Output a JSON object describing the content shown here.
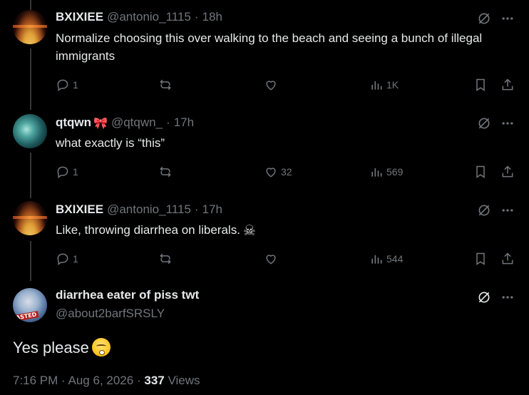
{
  "replies": [
    {
      "name": "BXIXIEE",
      "handle": "@antonio_1115",
      "time": "18h",
      "text": "Normalize choosing this over walking to the beach and seeing a bunch of illegal immigrants",
      "replies": "1",
      "reposts": "",
      "likes": "",
      "views": "1K"
    },
    {
      "name": "qtqwn",
      "handle": "@qtqwn_",
      "time": "17h",
      "text": "what exactly is “this”",
      "replies": "1",
      "reposts": "",
      "likes": "32",
      "views": "569"
    },
    {
      "name": "BXIXIEE",
      "handle": "@antonio_1115",
      "time": "17h",
      "text": "Like, throwing diarrhea on liberals.",
      "replies": "1",
      "reposts": "",
      "likes": "",
      "views": "544"
    }
  ],
  "main_tweet": {
    "name": "diarrhea eater of piss twt",
    "handle": "@about2barfSRSLY",
    "text": "Yes please",
    "time": "7:16 PM",
    "date": "Aug 6, 2026",
    "views_count": "337",
    "views_label": "Views",
    "avatar_stamp": "ASTED"
  },
  "icons": {
    "grok": "grok-icon",
    "more": "more-icon",
    "reply": "reply-icon",
    "repost": "repost-icon",
    "like": "heart-icon",
    "views": "views-icon",
    "bookmark": "bookmark-icon",
    "share": "share-icon"
  },
  "separator": "·",
  "emojis": {
    "bow": "🎀",
    "skull": "☠"
  },
  "colors": {
    "background": "#000000",
    "text": "#e7e9ea",
    "secondary": "#71767b",
    "thread_line": "#333639"
  }
}
